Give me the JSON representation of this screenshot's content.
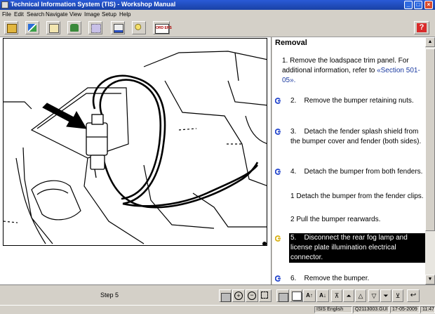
{
  "window": {
    "title": "Technical Information System (TIS) - Workshop Manual"
  },
  "menu": [
    "File",
    "Edit",
    "Search",
    "Navigate",
    "View",
    "Image",
    "Setup",
    "Help"
  ],
  "toolbar": {
    "orders_label": "ORD ERS"
  },
  "figure": {
    "id": "TNV4302118"
  },
  "procedure": {
    "title": "Removal",
    "steps": [
      {
        "num": "1.",
        "text": "Remove the loadspace trim panel. For additional information, refer to",
        "link": "«Section 501-05»."
      },
      {
        "num": "2.",
        "text": "Remove the bumper retaining nuts."
      },
      {
        "num": "3.",
        "text": "Detach the fender splash shield from the bumper cover and fender (both sides)."
      },
      {
        "num": "4.",
        "text": "Detach the bumper from both fenders."
      },
      {
        "num": "1",
        "text": "Detach the bumper from the fender clips."
      },
      {
        "num": "2",
        "text": "Pull the bumper rearwards."
      },
      {
        "num": "5.",
        "text": "Disconnect the rear fog lamp and license plate illumination electrical connector."
      },
      {
        "num": "6.",
        "text": "Remove the bumper."
      }
    ]
  },
  "bottom": {
    "step_label": "Step 5"
  },
  "status": {
    "language": "ISIS English",
    "file": "Q2113003.GUI",
    "date": "17-05-2009",
    "time": "11:47"
  }
}
